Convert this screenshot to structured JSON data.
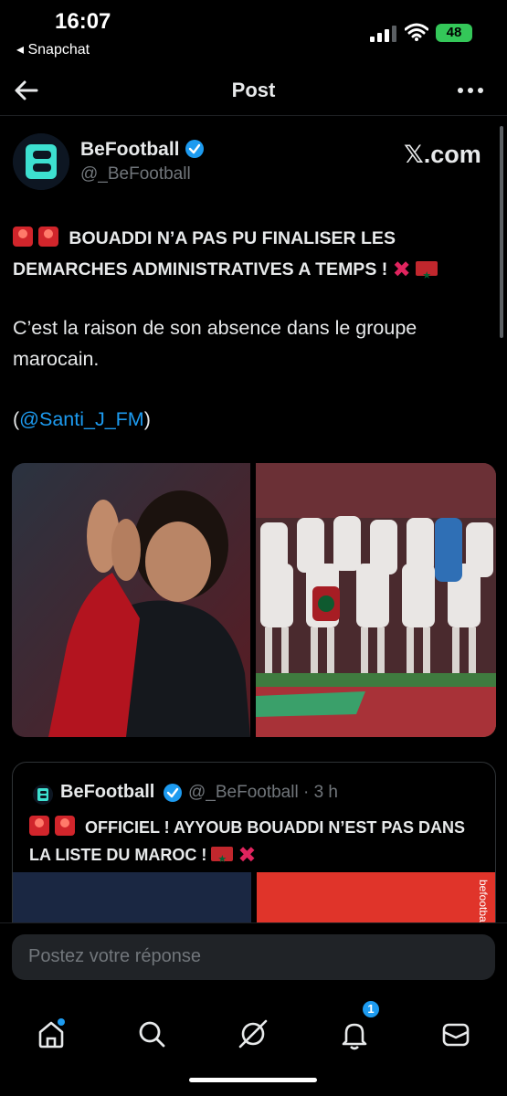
{
  "status_bar": {
    "time": "16:07",
    "back_app": "◂ Snapchat",
    "battery": "48"
  },
  "header": {
    "title": "Post"
  },
  "tweet": {
    "author_name": "BeFootball",
    "handle": "@_BeFootball",
    "source": "𝕏.com",
    "headline": "BOUADDI N’A PAS PU FINALISER LES DEMARCHES ADMINISTRATIVES A TEMPS !",
    "body": "C’est la raison de son absence dans le groupe marocain.",
    "mention_open": "(",
    "mention": "@Santi_J_FM",
    "mention_close": ")"
  },
  "quote": {
    "author_name": "BeFootball",
    "handle_time": "@_BeFootball · 3 h",
    "text": "OFFICIEL ! AYYOUB BOUADDI N’EST PAS DANS LA LISTE DU MAROC !",
    "brand": "befootball"
  },
  "reply": {
    "placeholder": "Postez votre réponse"
  },
  "tabs": {
    "notifications_count": "1"
  },
  "colors": {
    "accent": "#1d9bf0",
    "background": "#000000",
    "muted": "#71767b"
  }
}
